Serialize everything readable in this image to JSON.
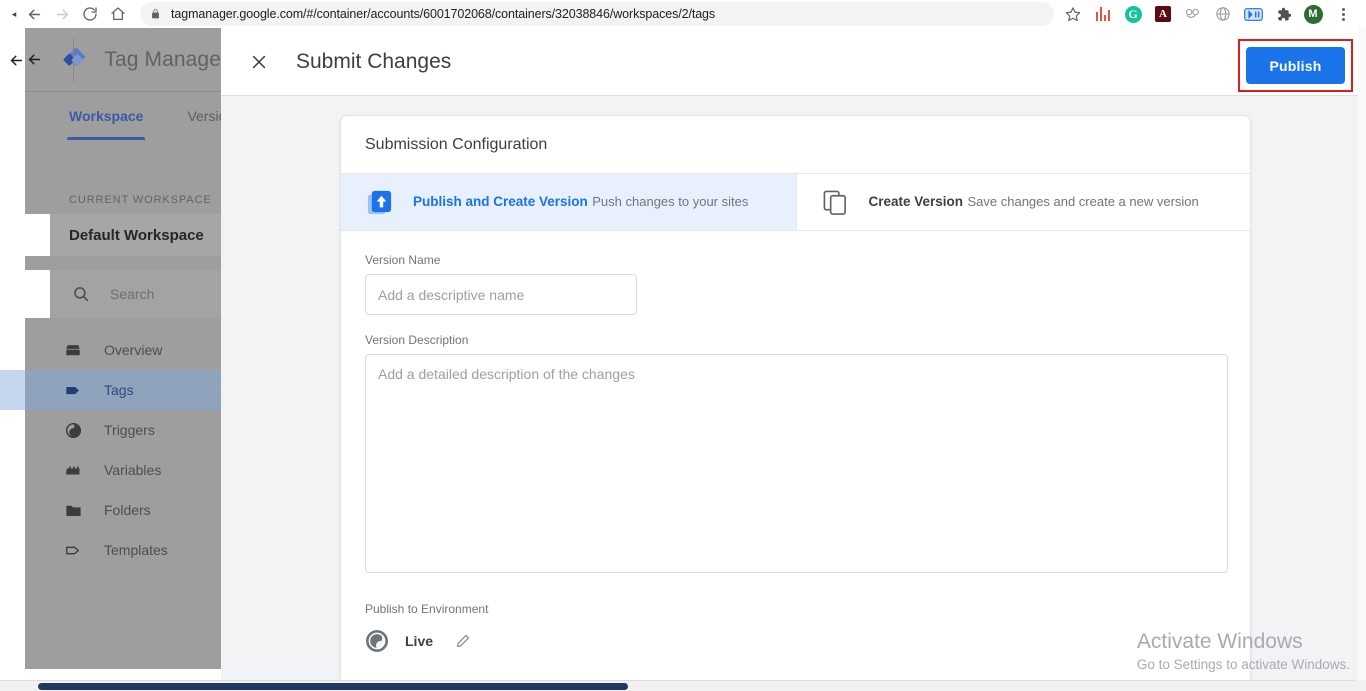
{
  "browser": {
    "url": "tagmanager.google.com/#/container/accounts/6001702068/containers/32038846/workspaces/2/tags",
    "back_tooltip": "Back",
    "forward_tooltip": "Forward",
    "reload_tooltip": "Reload",
    "home_tooltip": "Home",
    "bookmark_tooltip": "Bookmark this tab",
    "extensions": [
      {
        "name": "bar-chart-extension-icon",
        "label": ""
      },
      {
        "name": "grammarly-extension-icon",
        "label": "G"
      },
      {
        "name": "adobe-acrobat-extension-icon",
        "label": "A"
      },
      {
        "name": "link-chain-extension-icon",
        "label": ""
      },
      {
        "name": "globe-extension-icon",
        "label": ""
      },
      {
        "name": "blue-tag-extension-icon",
        "label": ""
      },
      {
        "name": "puzzle-extensions-icon",
        "label": ""
      }
    ],
    "profile_initial": "M",
    "menu_tooltip": "Customize and control Google Chrome"
  },
  "app": {
    "product_title": "Tag Manage",
    "tabs": [
      {
        "label": "Workspace",
        "active": true
      },
      {
        "label": "Versions",
        "active": false
      }
    ],
    "sidebar": {
      "section_label": "CURRENT WORKSPACE",
      "workspace_name": "Default Workspace",
      "workspace_chevron": "›",
      "search_placeholder": "Search",
      "items": [
        {
          "label": "Overview",
          "icon": "overview-icon",
          "selected": false
        },
        {
          "label": "Tags",
          "icon": "tag-filled-icon",
          "selected": true
        },
        {
          "label": "Triggers",
          "icon": "trigger-icon",
          "selected": false
        },
        {
          "label": "Variables",
          "icon": "variables-icon",
          "selected": false
        },
        {
          "label": "Folders",
          "icon": "folder-icon",
          "selected": false
        },
        {
          "label": "Templates",
          "icon": "template-tag-icon",
          "selected": false
        }
      ]
    }
  },
  "panel": {
    "title": "Submit Changes",
    "close_label": "×",
    "publish_label": "Publish"
  },
  "card": {
    "title": "Submission Configuration",
    "options": [
      {
        "heading": "Publish and Create Version",
        "subtext": "Push changes to your sites",
        "icon": "publish-upload-icon",
        "selected": true
      },
      {
        "heading": "Create Version",
        "subtext": "Save changes and create a new version",
        "icon": "copy-version-icon",
        "selected": false
      }
    ],
    "version_name_label": "Version Name",
    "version_name_value": "",
    "version_name_placeholder": "Add a descriptive name",
    "version_description_label": "Version Description",
    "version_description_value": "",
    "version_description_placeholder": "Add a detailed description of the changes",
    "environment_label": "Publish to Environment",
    "environment_name": "Live",
    "environment_icon": "globe-icon",
    "environment_edit_icon": "pencil-icon"
  },
  "watermark": {
    "title": "Activate Windows",
    "subtitle": "Go to Settings to activate Windows."
  }
}
